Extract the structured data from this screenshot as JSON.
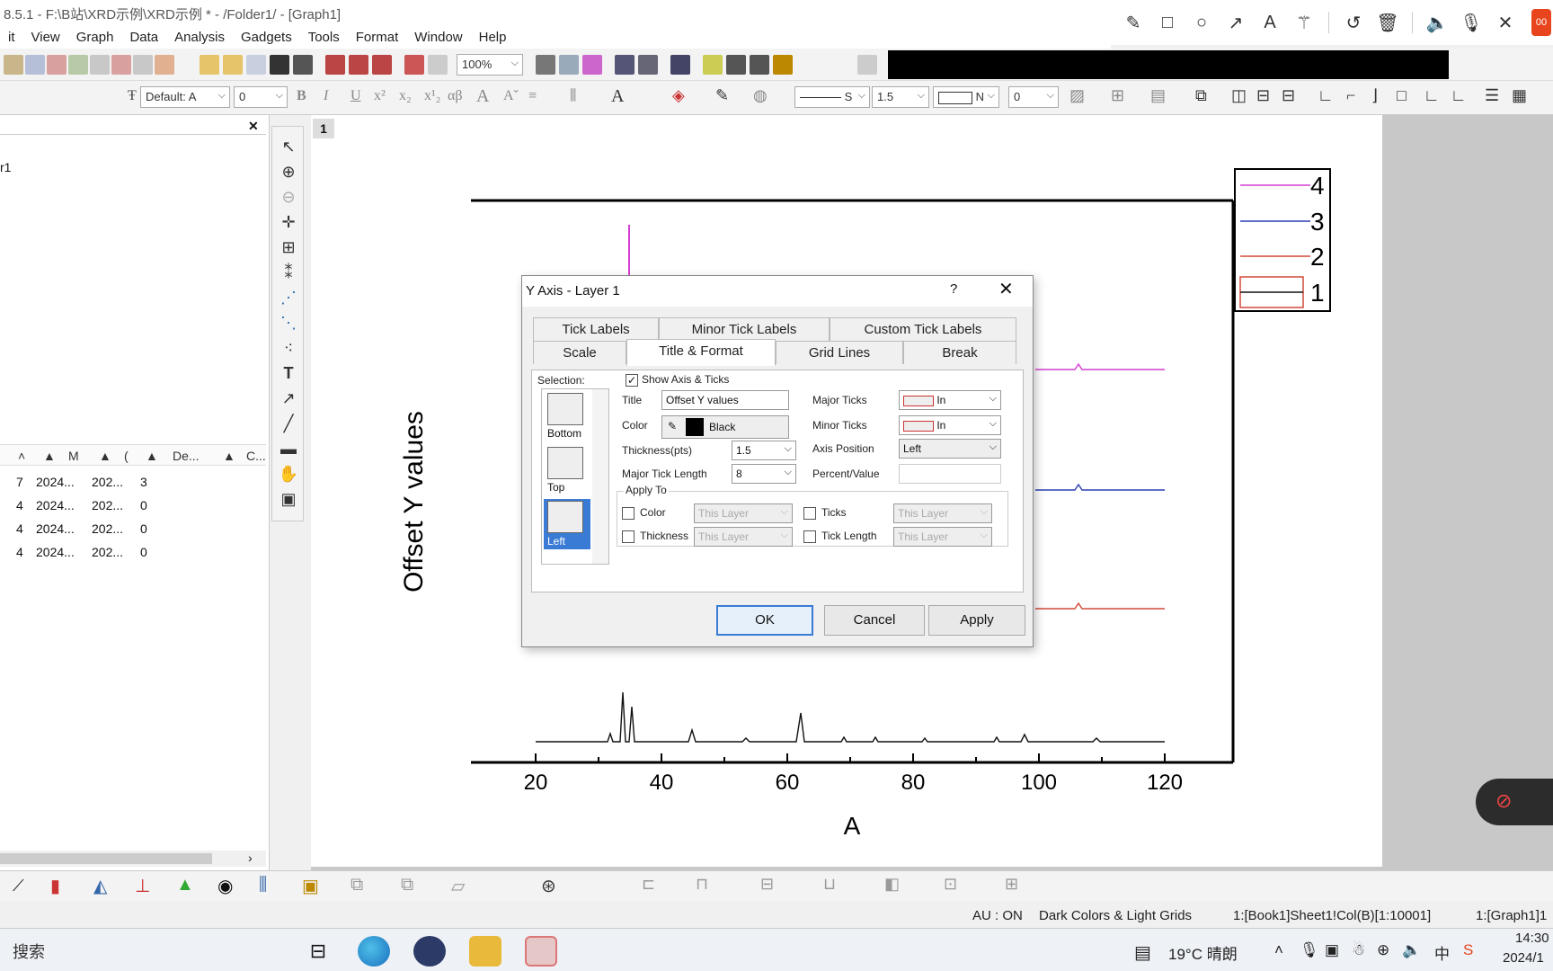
{
  "titlebar": {
    "text": "8.5.1 - F:\\B站\\XRD示例\\XRD示例 * - /Folder1/ - [Graph1]"
  },
  "annot_tools": [
    "pencil-icon",
    "square-icon",
    "circle-icon",
    "arrow-icon",
    "text-icon",
    "magic-wand-icon",
    "undo-icon",
    "trash-icon",
    "speaker-icon",
    "mic-icon",
    "close-icon"
  ],
  "annot_rec_label": "00",
  "menu": [
    "it",
    "View",
    "Graph",
    "Data",
    "Analysis",
    "Gadgets",
    "Tools",
    "Format",
    "Window",
    "Help"
  ],
  "toolbar": {
    "zoom": "100%",
    "font": "Default: A",
    "font_size": "0",
    "line_style": "S",
    "line_width": "1.5",
    "pattern": "N",
    "pattern_size": "0"
  },
  "explorer": {
    "folder_label": "r1",
    "columns": [
      "M",
      "(",
      "De...",
      "C..."
    ],
    "rows": [
      {
        "a": "7",
        "b": "2024...",
        "c": "202...",
        "d": "3"
      },
      {
        "a": "4",
        "b": "2024...",
        "c": "202...",
        "d": "0"
      },
      {
        "a": "4",
        "b": "2024...",
        "c": "202...",
        "d": "0"
      },
      {
        "a": "4",
        "b": "2024...",
        "c": "202...",
        "d": "0"
      }
    ]
  },
  "graph": {
    "layer_label": "1",
    "ylabel": "Offset Y values",
    "xlabel": "A",
    "xticks": [
      "20",
      "40",
      "60",
      "80",
      "100",
      "120"
    ],
    "legend": [
      "4",
      "3",
      "2",
      "1"
    ],
    "colors": {
      "s4": "#d43dd4",
      "s3": "#2a3fb0",
      "s2": "#d2483a",
      "s1": "#111111"
    }
  },
  "dialog": {
    "title": "Y Axis - Layer 1",
    "help": "?",
    "close": "✕",
    "tabs_row1": [
      "Tick Labels",
      "Minor Tick Labels",
      "Custom Tick Labels"
    ],
    "tabs_row2": [
      "Scale",
      "Title & Format",
      "Grid Lines",
      "Break"
    ],
    "selection_label": "Selection:",
    "selection_items": [
      "Bottom",
      "Top",
      "Left"
    ],
    "show_axis_label": "Show Axis & Ticks",
    "title_label": "Title",
    "title_value": "Offset Y values",
    "color_label": "Color",
    "color_value": "Black",
    "thickness_label": "Thickness(pts)",
    "thickness_value": "1.5",
    "major_tick_len_label": "Major Tick Length",
    "major_tick_len_value": "8",
    "major_ticks_label": "Major Ticks",
    "major_ticks_value": "In",
    "minor_ticks_label": "Minor Ticks",
    "minor_ticks_value": "In",
    "axis_position_label": "Axis Position",
    "axis_position_value": "Left",
    "percent_label": "Percent/Value",
    "apply_to_label": "Apply To",
    "apply_color": "Color",
    "apply_thickness": "Thickness",
    "apply_ticks": "Ticks",
    "apply_ticklen": "Tick Length",
    "this_layer": "This Layer",
    "ok": "OK",
    "cancel": "Cancel",
    "apply": "Apply"
  },
  "status": {
    "au": "AU : ON",
    "theme": "Dark Colors & Light Grids",
    "cell": "1:[Book1]Sheet1!Col(B)[1:10001]",
    "graph": "1:[Graph1]1"
  },
  "taskbar": {
    "search": "搜索",
    "weather": "19°C 晴朗",
    "ime": "中",
    "time": "14:30",
    "date": "2024/1"
  }
}
